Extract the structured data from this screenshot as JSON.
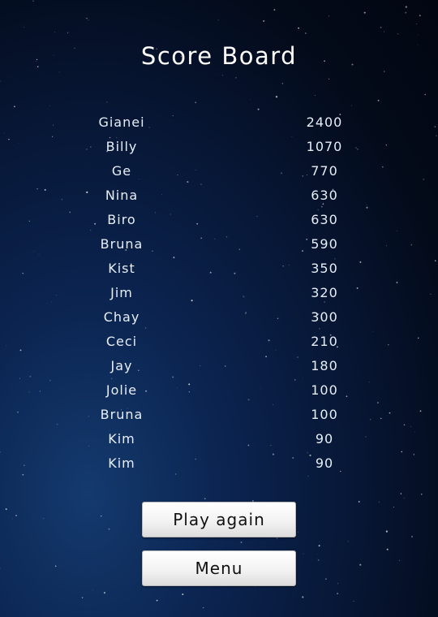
{
  "title": "Score Board",
  "scores": [
    {
      "name": "Gianei",
      "score": "2400"
    },
    {
      "name": "Billy",
      "score": "1070"
    },
    {
      "name": "Ge",
      "score": "770"
    },
    {
      "name": "Nina",
      "score": "630"
    },
    {
      "name": "Biro",
      "score": "630"
    },
    {
      "name": "Bruna",
      "score": "590"
    },
    {
      "name": "Kist",
      "score": "350"
    },
    {
      "name": "Jim",
      "score": "320"
    },
    {
      "name": "Chay",
      "score": "300"
    },
    {
      "name": "Ceci",
      "score": "210"
    },
    {
      "name": "Jay",
      "score": "180"
    },
    {
      "name": "Jolie",
      "score": "100"
    },
    {
      "name": "Bruna",
      "score": "100"
    },
    {
      "name": "Kim",
      "score": "90"
    },
    {
      "name": "Kim",
      "score": "90"
    }
  ],
  "buttons": {
    "play_again": "Play again",
    "menu": "Menu"
  },
  "colors": {
    "background_center": "#143a6e",
    "background_edge": "#020611",
    "text": "#e8eef8",
    "button_face": "#f1f1f1"
  }
}
